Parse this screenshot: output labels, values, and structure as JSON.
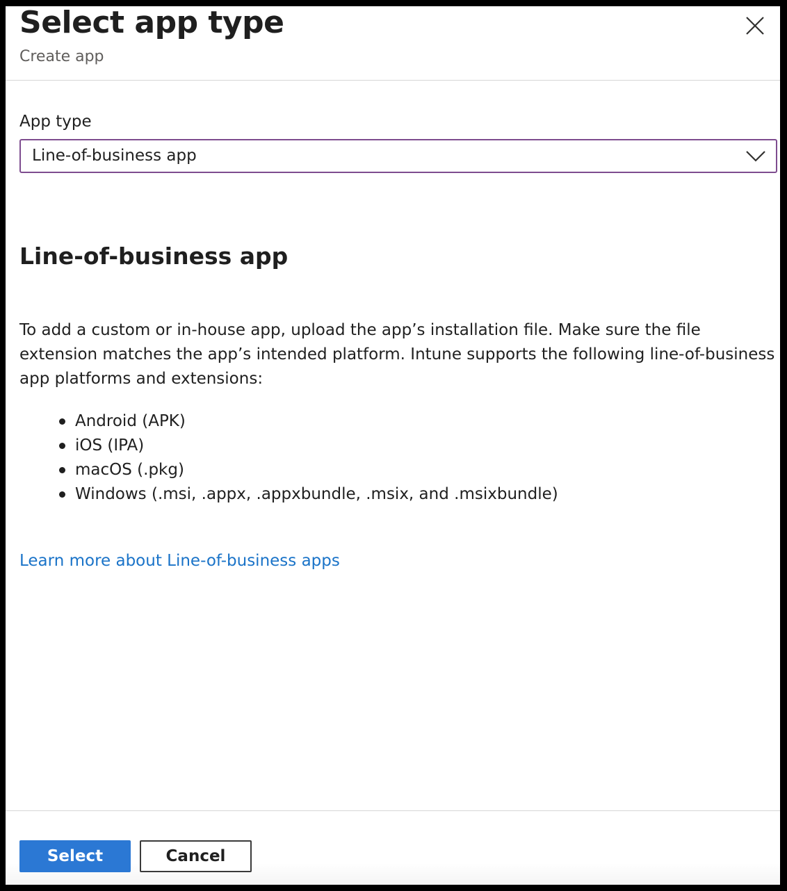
{
  "header": {
    "title": "Select app type",
    "subtitle": "Create app"
  },
  "form": {
    "app_type_label": "App type",
    "app_type_value": "Line-of-business app"
  },
  "content": {
    "heading": "Line-of-business app",
    "description": "To add a custom or in-house app, upload the app’s installation file. Make sure the file extension matches the app’s intended platform. Intune supports the following line-of-business app platforms and extensions:",
    "platforms": [
      "Android (APK)",
      "iOS (IPA)",
      "macOS (.pkg)",
      "Windows (.msi, .appx, .appxbundle, .msix, and .msixbundle)"
    ],
    "learn_more_link": "Learn more about Line-of-business apps"
  },
  "footer": {
    "select_label": "Select",
    "cancel_label": "Cancel"
  },
  "icons": {
    "close": "close-icon",
    "chevron": "chevron-down-icon"
  },
  "colors": {
    "primary_button": "#2b78d4",
    "link": "#1a73c8",
    "select_border": "#7e4c8f"
  }
}
